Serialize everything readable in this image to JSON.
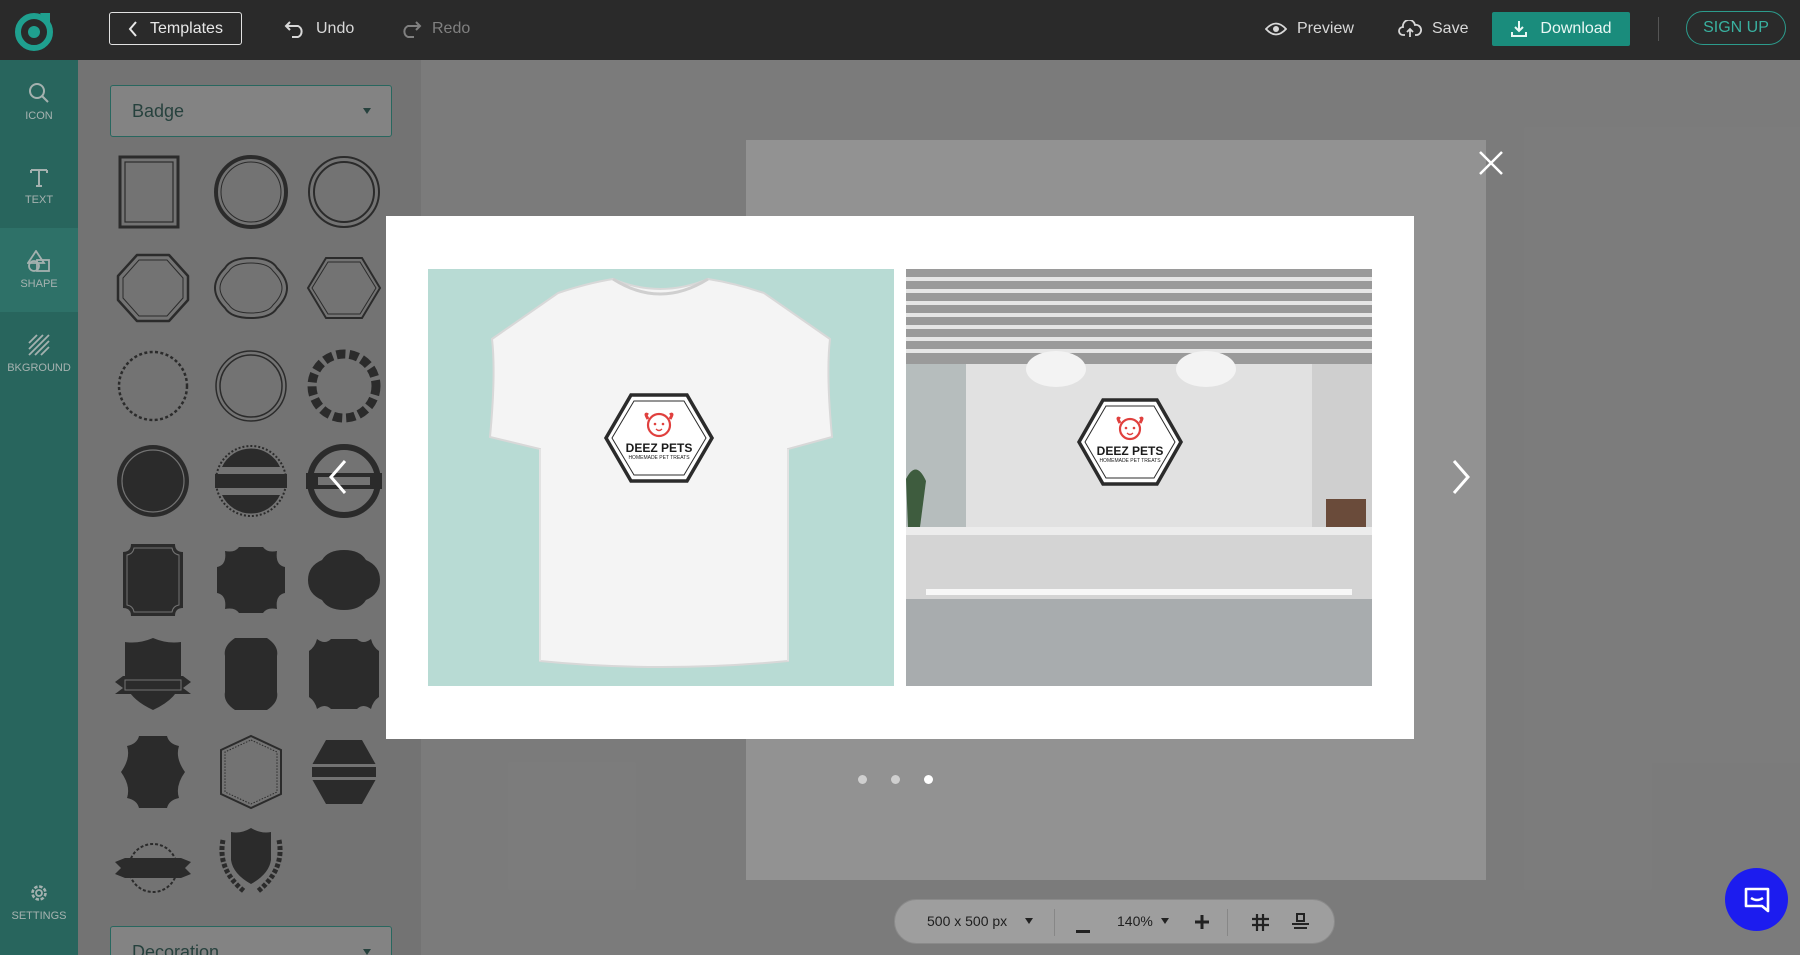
{
  "topbar": {
    "templates_label": "Templates",
    "undo_label": "Undo",
    "redo_label": "Redo",
    "preview_label": "Preview",
    "save_label": "Save",
    "download_label": "Download",
    "signup_label": "SIGN UP"
  },
  "rail": {
    "items": [
      {
        "label": "ICON",
        "icon": "search-icon"
      },
      {
        "label": "TEXT",
        "icon": "text-icon"
      },
      {
        "label": "SHAPE",
        "icon": "shapes-icon"
      },
      {
        "label": "BKGROUND",
        "icon": "background-icon"
      }
    ],
    "settings_label": "SETTINGS",
    "active_item": "SHAPE"
  },
  "panel": {
    "category_label": "Badge",
    "next_category_label": "Decoration"
  },
  "preview_modal": {
    "mockups": [
      {
        "type": "t-shirt",
        "brand": "DEEZ PETS",
        "tagline": "HOMEMADE PET TREATS"
      },
      {
        "type": "office-wall",
        "brand": "DEEZ PETS",
        "tagline": "HOMEMADE PET TREATS"
      }
    ],
    "slide_count": 3,
    "active_slide": 3
  },
  "bottom_toolbar": {
    "size_label": "500 x 500 px",
    "zoom_label": "140%"
  },
  "colors": {
    "accent": "#1a8c7c",
    "rail": "#1a776b",
    "topbar": "#2a2a2a",
    "logo_red": "#e0403e",
    "chat": "#1c1cef"
  }
}
